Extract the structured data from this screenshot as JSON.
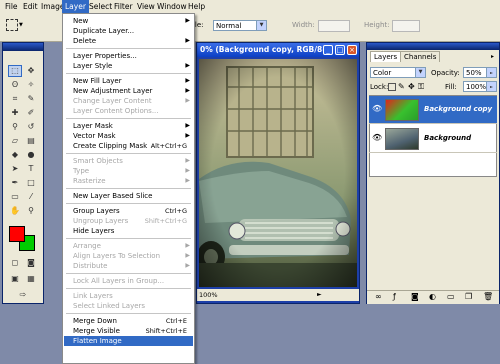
{
  "menubar": {
    "items": [
      "File",
      "Edit",
      "Image",
      "Layer",
      "Select",
      "Filter",
      "View",
      "Window",
      "Help"
    ],
    "active": "Layer"
  },
  "options": {
    "style_label": "tyle:",
    "style_value": "Normal",
    "width_label": "Width:",
    "height_label": "Height:"
  },
  "document": {
    "title": "0% (Background copy, RGB/8#)",
    "status_zoom": "100%"
  },
  "layers_panel": {
    "tabs": [
      "Layers",
      "Channels"
    ],
    "blend_mode": "Color",
    "opacity_label": "Opacity:",
    "opacity_value": "50%",
    "lock_label": "Lock:",
    "fill_label": "Fill:",
    "fill_value": "100%",
    "layers": [
      {
        "name": "Background copy",
        "selected": true
      },
      {
        "name": "Background",
        "selected": false
      }
    ]
  },
  "layer_menu": {
    "items": [
      {
        "label": "New",
        "type": "submenu",
        "enabled": true
      },
      {
        "label": "Duplicate Layer...",
        "enabled": true
      },
      {
        "label": "Delete",
        "type": "submenu",
        "enabled": true
      },
      {
        "type": "separator"
      },
      {
        "label": "Layer Properties...",
        "enabled": true
      },
      {
        "label": "Layer Style",
        "type": "submenu",
        "enabled": true
      },
      {
        "type": "separator"
      },
      {
        "label": "New Fill Layer",
        "type": "submenu",
        "enabled": true
      },
      {
        "label": "New Adjustment Layer",
        "type": "submenu",
        "enabled": true
      },
      {
        "label": "Change Layer Content",
        "type": "submenu",
        "enabled": false
      },
      {
        "label": "Layer Content Options...",
        "enabled": false
      },
      {
        "type": "separator"
      },
      {
        "label": "Layer Mask",
        "type": "submenu",
        "enabled": true
      },
      {
        "label": "Vector Mask",
        "type": "submenu",
        "enabled": true
      },
      {
        "label": "Create Clipping Mask",
        "shortcut": "Alt+Ctrl+G",
        "enabled": true
      },
      {
        "type": "separator"
      },
      {
        "label": "Smart Objects",
        "type": "submenu",
        "enabled": false
      },
      {
        "label": "Type",
        "type": "submenu",
        "enabled": false
      },
      {
        "label": "Rasterize",
        "type": "submenu",
        "enabled": false
      },
      {
        "type": "separator"
      },
      {
        "label": "New Layer Based Slice",
        "enabled": true
      },
      {
        "type": "separator"
      },
      {
        "label": "Group Layers",
        "shortcut": "Ctrl+G",
        "enabled": true
      },
      {
        "label": "Ungroup Layers",
        "shortcut": "Shift+Ctrl+G",
        "enabled": false
      },
      {
        "label": "Hide Layers",
        "enabled": true
      },
      {
        "type": "separator"
      },
      {
        "label": "Arrange",
        "type": "submenu",
        "enabled": false
      },
      {
        "label": "Align Layers To Selection",
        "type": "submenu",
        "enabled": false
      },
      {
        "label": "Distribute",
        "type": "submenu",
        "enabled": false
      },
      {
        "type": "separator"
      },
      {
        "label": "Lock All Layers in Group...",
        "enabled": false
      },
      {
        "type": "separator"
      },
      {
        "label": "Link Layers",
        "enabled": false
      },
      {
        "label": "Select Linked Layers",
        "enabled": false
      },
      {
        "type": "separator"
      },
      {
        "label": "Merge Down",
        "shortcut": "Ctrl+E",
        "enabled": true
      },
      {
        "label": "Merge Visible",
        "shortcut": "Shift+Ctrl+E",
        "enabled": true
      },
      {
        "label": "Flatten Image",
        "enabled": true,
        "highlighted": true
      }
    ]
  },
  "colors": {
    "foreground": "#ff0000",
    "background": "#00cc00",
    "highlight": "#316ac5"
  }
}
